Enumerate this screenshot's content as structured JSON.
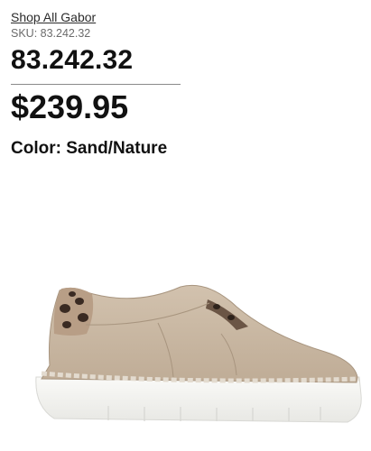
{
  "product": {
    "brand_link": "Shop All Gabor",
    "sku_text": "SKU: 83.242.32",
    "title": "83.242.32",
    "price": "$239.95",
    "color_label": "Color:",
    "color_value": "Sand/Nature"
  },
  "image": {
    "icon": "sneaker-product-image",
    "colors": {
      "upper": "#c9b8a3",
      "sole": "#f4f4f2",
      "stitching": "#e3dbcf",
      "leopard_base": "#b89e86",
      "leopard_spot": "#3a2a22"
    }
  }
}
